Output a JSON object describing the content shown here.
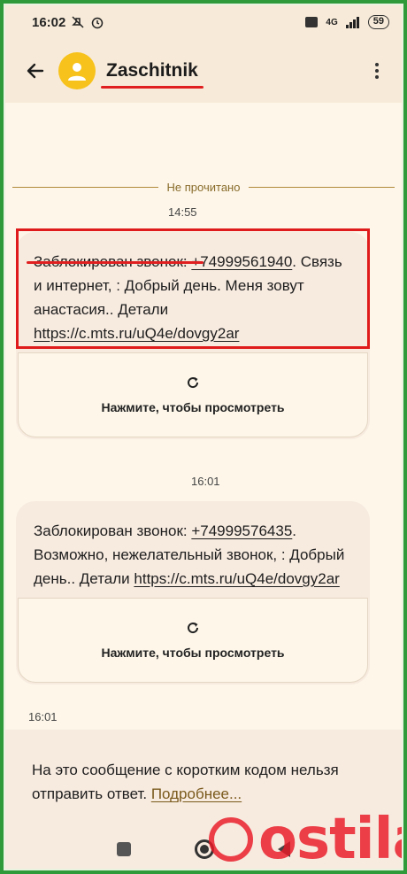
{
  "status_bar": {
    "time": "16:02",
    "network": "4G",
    "battery": "59"
  },
  "app_bar": {
    "contact_name": "Zaschitnik",
    "back_icon": "arrow-left-icon",
    "avatar_icon": "person-icon",
    "menu_icon": "more-vert-icon"
  },
  "conversation": {
    "unread_label": "Не прочитано",
    "messages": [
      {
        "time": "14:55",
        "prefix": "Заблокирован звонок",
        "colon": ": ",
        "phone": "+74999561940",
        "body": ". Связь и интернет, : Добрый день. Меня зовут анастасия.. Детали ",
        "link": "https://c.mts.ru/uQ4e/dovgy2ar",
        "preview_label": "Нажмите, чтобы просмотреть"
      },
      {
        "time": "16:01",
        "prefix": "Заблокирован звонок",
        "colon": ": ",
        "phone": "+74999576435",
        "body": ". Возможно, нежелательный звонок, : Добрый день.. Детали ",
        "link": "https://c.mts.ru/uQ4e/dovgy2ar",
        "preview_label": "Нажмите, чтобы просмотреть",
        "sent_time": "16:01"
      }
    ]
  },
  "notice": {
    "text": "На это сообщение с коротким кодом нельзя отправить ответ. ",
    "link": "Подробнее..."
  },
  "watermark": {
    "text": "ostila.ru"
  },
  "colors": {
    "accent_red": "#e02020",
    "avatar": "#f7c21b",
    "background": "#fdf6e9",
    "frame": "#2f9a3a"
  }
}
